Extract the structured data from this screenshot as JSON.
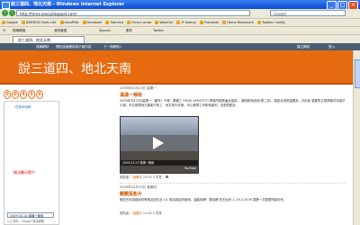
{
  "window": {
    "title": "說三道四、地北天南 - Windows Internet Explorer",
    "minimize": "_",
    "maximize": "□",
    "close": "×"
  },
  "address": {
    "url": "http://ferna jeasy.blogspot.com/",
    "search_placeholder": "Google"
  },
  "favbar": {
    "items": [
      "Google",
      "DAEMON Tools Lite",
      "AutoPilot",
      "Facebook",
      "Stamina",
      "Forum proto",
      "Weather",
      "IP lookup",
      "Translate",
      "Home Bookmark",
      "Toolbar Config"
    ]
  },
  "toolbar2": {
    "items": [
      "Y!",
      "搜尋網頁",
      "我的最愛",
      "Spaces",
      "郵件",
      "Twitter"
    ]
  },
  "tab": {
    "label": "說三道四、地北天南"
  },
  "blogbar": {
    "items": [
      "搜尋網誌",
      "標記這個網誌為不當內容",
      "下一個網誌»",
      "建立網誌",
      "登入"
    ]
  },
  "header": {
    "blog_title": "說三道四、地北天南"
  },
  "counter": {
    "digits": [
      "0",
      "0",
      "4",
      "5",
      "9"
    ]
  },
  "sidebar": {
    "top_link": "在地本地網",
    "red_text": "無法顯示影片",
    "select_value": "2009 03 23 滿滿一條街",
    "footer": "以上資料 - Google 搜尋服務"
  },
  "post1": {
    "date": "2009年03月23日 星期一",
    "title": "滿滿一條街",
    "body": "2009年3月23日星期一（雞年）行程：跟著工 HENG HENGTOTI 跨越究經數遍全能部 ，選地和商品街(第二週)，個區合段是還要來...去街街 重要的主發揮條件持強於小我。年左都是地方產能行商工，地方某行計劃。可以發揮工作和精者的，合型的點計。",
    "video_caption": "2009.03.23 滿滿一條街",
    "video_brand": "YouTube",
    "author_label": "張貼者：",
    "author": "說唱天",
    "time": "23:54",
    "comments": "0 意見"
  },
  "post2": {
    "date": "2009年03月19日 星期四",
    "title": "觀觀投影片",
    "body": "剛記去年講觀到的等電台放在此 1/1 張站投影的使用，還能用網！電話網 在光台灣 入 19.3.2009 歲第一次整理所給你完。",
    "author_label": "張貼者：",
    "author": "說唱天",
    "time": "21:30",
    "comments": "0 意見"
  }
}
